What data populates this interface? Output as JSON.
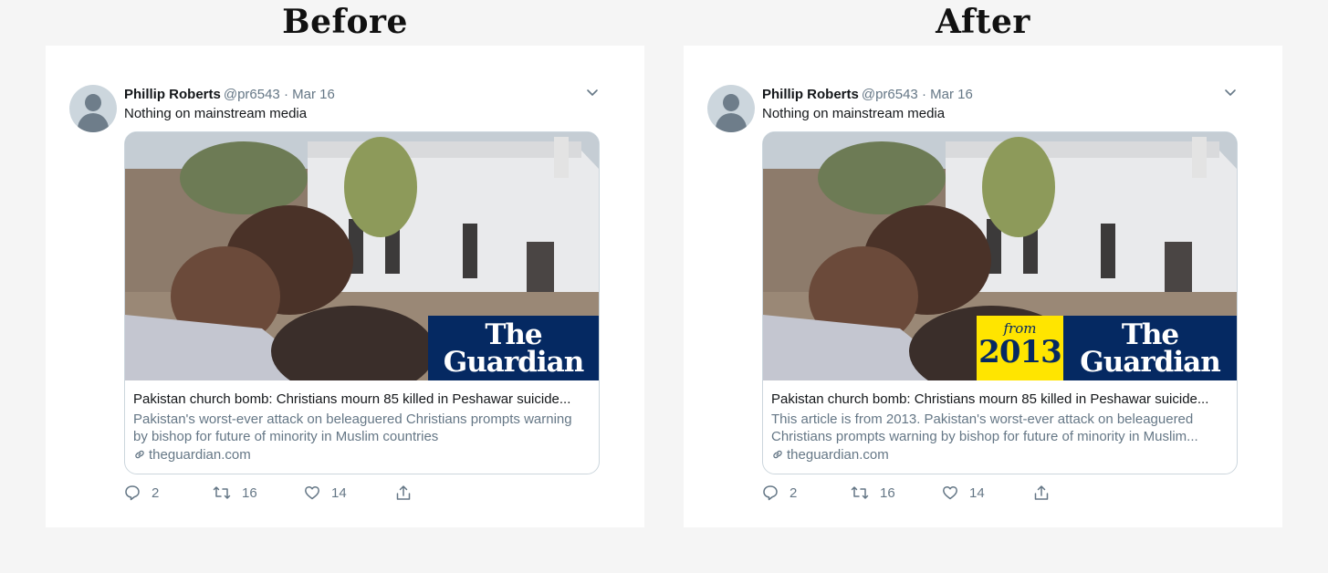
{
  "headings": {
    "before": "Before",
    "after": "After"
  },
  "tweet": {
    "author_name": "Phillip Roberts",
    "meta": "@pr6543 · Mar 16",
    "text": "Nothing on mainstream media",
    "replies": "2",
    "retweets": "16",
    "likes": "14"
  },
  "before_card": {
    "brand_line1": "The",
    "brand_line2": "Guardian",
    "title": "Pakistan church bomb: Christians mourn 85 killed in Peshawar suicide...",
    "desc_line1": "Pakistan's worst-ever attack on beleaguered Christians prompts warning",
    "desc_line2": "by bishop for future of minority in Muslim countries",
    "domain": "theguardian.com"
  },
  "after_card": {
    "from_label": "from",
    "year": "2013",
    "brand_line1": "The",
    "brand_line2": "Guardian",
    "title": "Pakistan church bomb: Christians mourn 85 killed in Peshawar suicide...",
    "desc_line1": "This article is from 2013. Pakistan's worst-ever attack on beleaguered",
    "desc_line2": "Christians prompts warning by bishop for future of minority in Muslim...",
    "domain": "theguardian.com"
  },
  "colors": {
    "guardian_blue": "#052962",
    "date_yellow": "#ffe500",
    "muted_text": "#657786"
  },
  "icons": [
    "chevron-down-icon",
    "link-icon",
    "reply-icon",
    "retweet-icon",
    "like-icon",
    "share-icon"
  ]
}
